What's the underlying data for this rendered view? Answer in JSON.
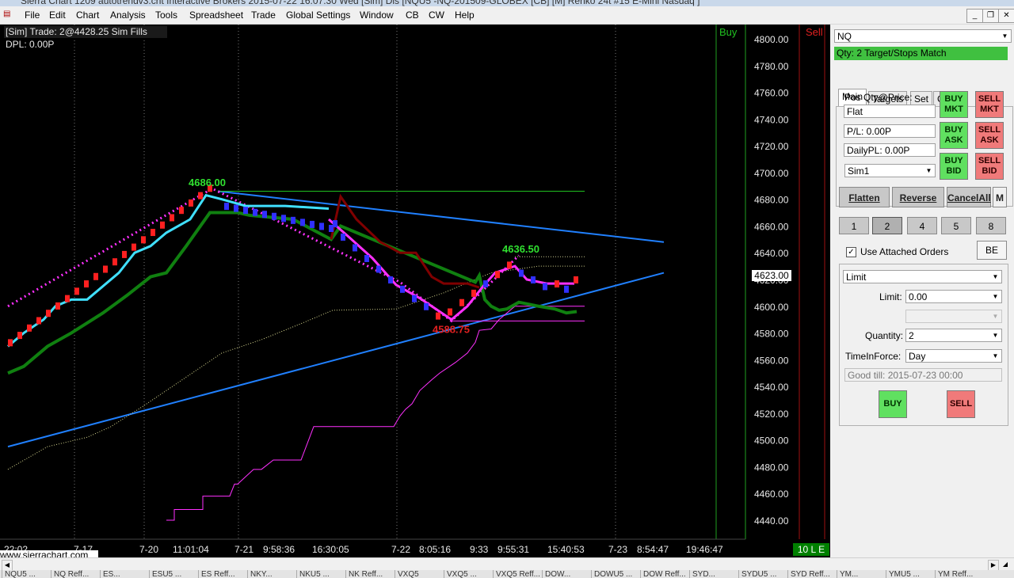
{
  "window": {
    "title": "Sierra Chart 1209 autotrendv3.cht  Interactive Brokers 2015-07-22  16:07:30 Wed [Sim]  Dis   [NQU5 -NQ-201509-GLOBEX [CB] [M]  Renko 24t  #15  E-Mini Nasdaq ]"
  },
  "menu": [
    "File",
    "Edit",
    "Chart",
    "Analysis",
    "Tools",
    "Spreadsheet",
    "Trade",
    "Global Settings",
    "Window",
    "CB",
    "CW",
    "Help"
  ],
  "chart": {
    "header_line1": "[Sim]  Trade: 2@4428.25  Sim Fills",
    "header_line2": "DPL: 0.00P",
    "buy_label": "Buy",
    "sell_label": "Sell",
    "status_label": "10 L E",
    "watermark": "www.sierrachart.com",
    "current_price": "4623.00",
    "high_label": "4686.00",
    "mid_label": "4636.50",
    "low_label": "4588.75",
    "price_ticks": [
      "4800.00",
      "4780.00",
      "4760.00",
      "4740.00",
      "4720.00",
      "4700.00",
      "4680.00",
      "4660.00",
      "4640.00",
      "4620.00",
      "4600.00",
      "4580.00",
      "4560.00",
      "4540.00",
      "4520.00",
      "4500.00",
      "4480.00",
      "4460.00",
      "4440.00"
    ],
    "time_ticks": [
      "22:02",
      "7-17",
      "7-20",
      "11:01:04",
      "7-21",
      "9:58:36",
      "16:30:05",
      "7-22",
      "8:05:16",
      "9:33",
      "9:55:31",
      "15:40:53",
      "7-23",
      "8:54:47",
      "19:46:47"
    ],
    "colors": {
      "up": "#ff2020",
      "down": "#3030ff",
      "cyan": "#40e0ff",
      "green": "#108010",
      "magenta": "#ff30ff",
      "darkred": "#800000",
      "blue": "#2080ff"
    }
  },
  "panel": {
    "symbol": "NQ",
    "status": "Qty: 2 Target/Stops Match",
    "tabs": [
      "Main",
      "Targets",
      "Set",
      "C"
    ],
    "pos_label": "Pos Qty@Price:",
    "pos_value": "Flat",
    "pl": "P/L: 0.00P",
    "daily_pl": "DailyPL: 0.00P",
    "account": "Sim1",
    "buy_mkt": "BUY MKT",
    "sell_mkt": "SELL MKT",
    "buy_ask": "BUY ASK",
    "sell_ask": "SELL ASK",
    "buy_bid": "BUY BID",
    "sell_bid": "SELL BID",
    "flatten": "Flatten",
    "reverse": "Reverse",
    "cancel_all": "CancelAll",
    "m": "M",
    "qty_buttons": [
      "1",
      "2",
      "4",
      "5",
      "8"
    ],
    "use_attached": "Use Attached Orders",
    "be": "BE",
    "order_type": "Limit",
    "limit_label": "Limit:",
    "limit_value": "0.00",
    "quantity_label": "Quantity:",
    "quantity_value": "2",
    "tif_label": "TimeInForce:",
    "tif_value": "Day",
    "good_till": "Good till: 2015-07-23 00:00",
    "buy": "BUY",
    "sell": "SELL"
  },
  "bottom_tabs": [
    "NQU5 ...",
    "NQ Reff...",
    "ES...",
    "ESU5 ...",
    "ES Reff...",
    "NKY...",
    "NKU5 ...",
    "NK Reff...",
    "VXQ5",
    "VXQ5 ...",
    "VXQ5 Reff...",
    "DOW...",
    "DOWU5 ...",
    "DOW Reff...",
    "SYD...",
    "SYDU5 ...",
    "SYD Reff...",
    "YM...",
    "YMU5 ...",
    "YM Reff..."
  ]
}
